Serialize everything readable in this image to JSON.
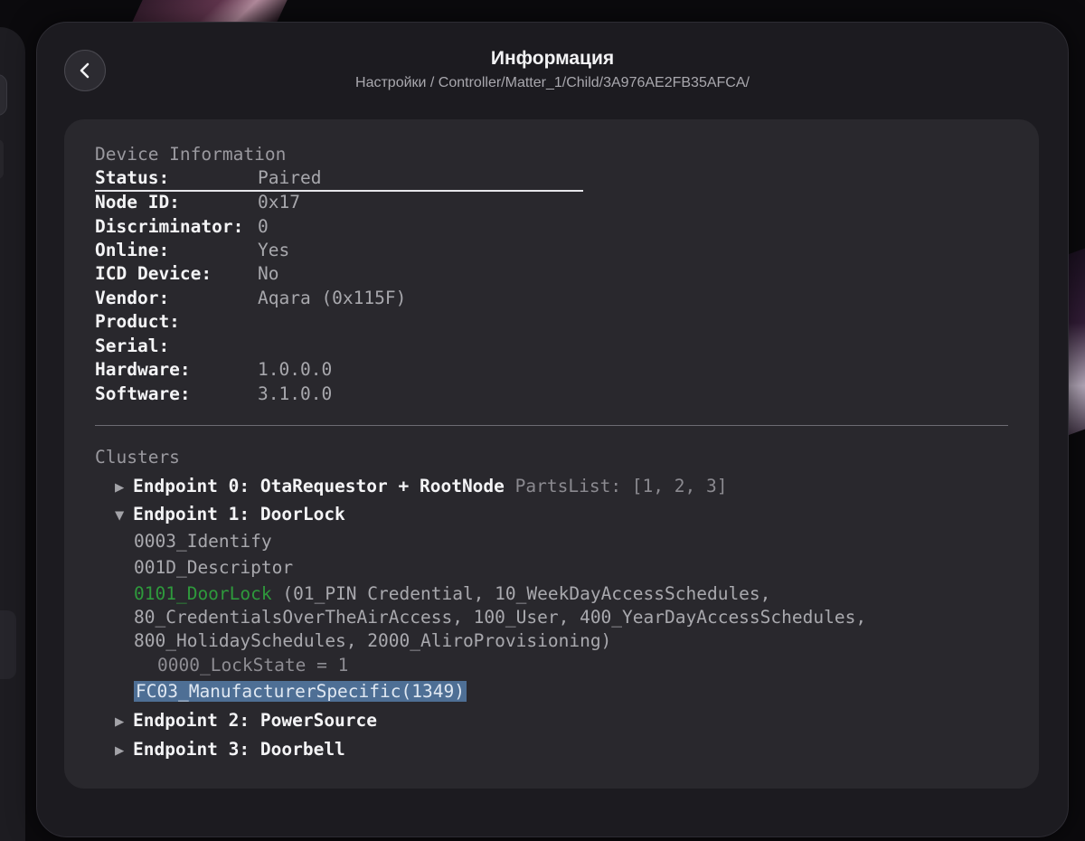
{
  "header": {
    "title": "Информация",
    "breadcrumb": "Настройки / Controller/Matter_1/Child/3A976AE2FB35AFCA/"
  },
  "device_information": {
    "heading": "Device Information",
    "rows": [
      {
        "key": "Status:",
        "value": "Paired"
      },
      {
        "key": "Node ID:",
        "value": "0x17"
      },
      {
        "key": "Discriminator:",
        "value": "0"
      },
      {
        "key": "Online:",
        "value": "Yes"
      },
      {
        "key": "ICD Device:",
        "value": "No"
      },
      {
        "key": "Vendor:",
        "value": "Aqara (0x115F)"
      },
      {
        "key": "Product:",
        "value": ""
      },
      {
        "key": "Serial:",
        "value": ""
      },
      {
        "key": "Hardware:",
        "value": "1.0.0.0"
      },
      {
        "key": "Software:",
        "value": "3.1.0.0"
      }
    ]
  },
  "clusters": {
    "heading": "Clusters",
    "endpoints": [
      {
        "arrow": "▶",
        "label": "Endpoint 0: OtaRequestor + RootNode",
        "extra": "PartsList: [1, 2, 3]"
      },
      {
        "arrow": "▼",
        "label": "Endpoint 1: DoorLock",
        "extra": ""
      },
      {
        "arrow": "▶",
        "label": "Endpoint 2: PowerSource",
        "extra": ""
      },
      {
        "arrow": "▶",
        "label": "Endpoint 3: Doorbell",
        "extra": ""
      }
    ],
    "endpoint1_clusters": {
      "identify": "0003_Identify",
      "descriptor": "001D_Descriptor",
      "doorlock_name": "0101_DoorLock",
      "doorlock_features_line1": " (01_PIN Credential, 10_WeekDayAccessSchedules,",
      "doorlock_features_line2": "80_CredentialsOverTheAirAccess, 100_User, 400_YearDayAccessSchedules,",
      "doorlock_features_line3": "800_HolidaySchedules, 2000_AliroProvisioning)",
      "lockstate_attr": "0000_LockState = 1",
      "manufacturer_specific": "FC03_ManufacturerSpecific(1349)"
    }
  },
  "colors": {
    "background": "#0b0a0d",
    "window": "#1c1b20",
    "card": "#29282d",
    "green": "#2e9a3c",
    "selection": "#4e6f95"
  },
  "icons": {
    "back": "chevron-left-icon",
    "collapsed": "triangle-right-icon",
    "expanded": "triangle-down-icon"
  }
}
